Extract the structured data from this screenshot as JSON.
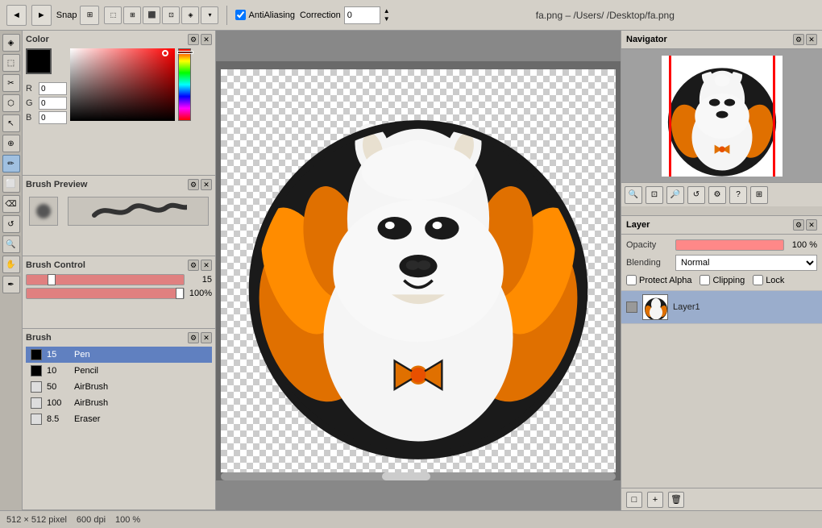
{
  "toolbar": {
    "snap_label": "Snap",
    "antialiasing_label": "AntiAliasing",
    "correction_label": "Correction",
    "correction_value": "0",
    "filename": "fa.png – /Users/        /Desktop/fa.png"
  },
  "left_tools": [
    "◈",
    "⬚",
    "✂",
    "⬡",
    "↖",
    "⊕",
    "✏",
    "⬜",
    "⌫",
    "◷",
    "🔍",
    "✋"
  ],
  "color_panel": {
    "title": "Color",
    "r_label": "R",
    "r_value": "0",
    "g_label": "G",
    "g_value": "0",
    "b_label": "B",
    "b_value": "0"
  },
  "brush_preview_panel": {
    "title": "Brush Preview"
  },
  "brush_control_panel": {
    "title": "Brush Control",
    "size_value": "15",
    "opacity_value": "100%"
  },
  "brush_list_panel": {
    "title": "Brush",
    "brushes": [
      {
        "size": "15",
        "name": "Pen",
        "active": true,
        "dark": true
      },
      {
        "size": "10",
        "name": "Pencil",
        "active": false,
        "dark": true
      },
      {
        "size": "50",
        "name": "AirBrush",
        "active": false,
        "dark": false
      },
      {
        "size": "100",
        "name": "AirBrush",
        "active": false,
        "dark": false
      },
      {
        "size": "8.5",
        "name": "Eraser",
        "active": false,
        "dark": false
      }
    ]
  },
  "navigator": {
    "title": "Navigator"
  },
  "layer_panel": {
    "title": "Layer",
    "opacity_label": "Opacity",
    "opacity_value": "100 %",
    "blending_label": "Blending",
    "blending_value": "Normal",
    "protect_alpha_label": "Protect Alpha",
    "clipping_label": "Clipping",
    "lock_label": "Lock",
    "layers": [
      {
        "name": "Layer1",
        "active": true
      }
    ]
  },
  "status_bar": {
    "dimensions": "512 × 512 pixel",
    "dpi": "600 dpi",
    "zoom": "100 %"
  }
}
